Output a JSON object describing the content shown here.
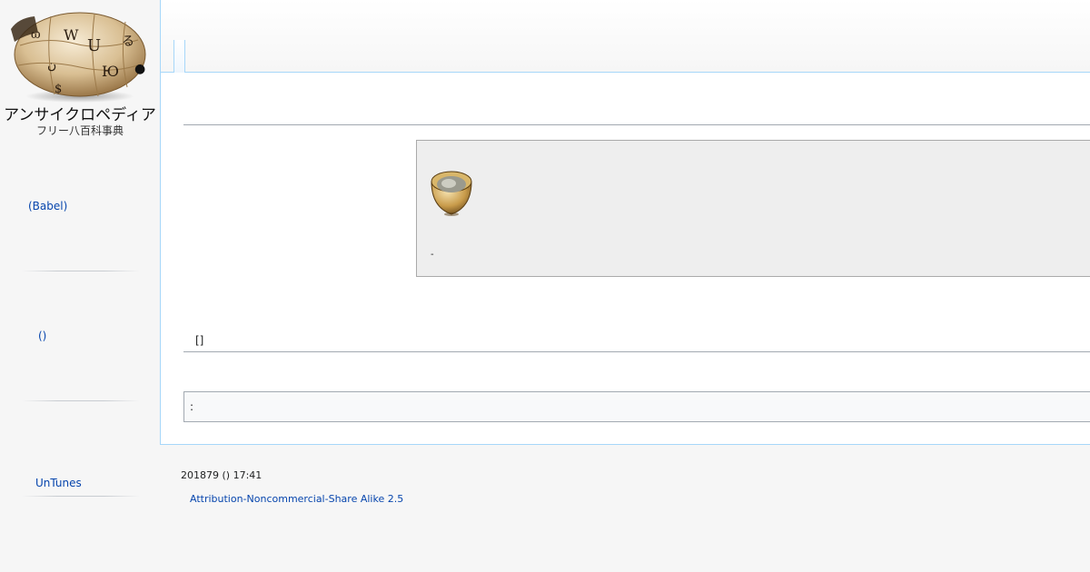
{
  "logo": {
    "title": "アンサイクロペディア",
    "subtitle": "フリー八百科事典",
    "icon": "puzzle-globe-icon"
  },
  "sidebar": {
    "babel_link": "(Babel)",
    "paren_link": "()",
    "untunes_link": "UnTunes"
  },
  "notice": {
    "icon": "sake-cup-icon",
    "text": "-"
  },
  "section": {
    "edit_label": "[]"
  },
  "catlinks": {
    "label": ":"
  },
  "footer": {
    "last_modified": "201879 () 17:41",
    "license_link": "Attribution-Noncommercial-Share Alike 2.5"
  },
  "colors": {
    "link": "#0645ad",
    "panel_border": "#a7d7f9",
    "notice_bg": "#eeeeee",
    "page_bg": "#f6f6f6"
  }
}
